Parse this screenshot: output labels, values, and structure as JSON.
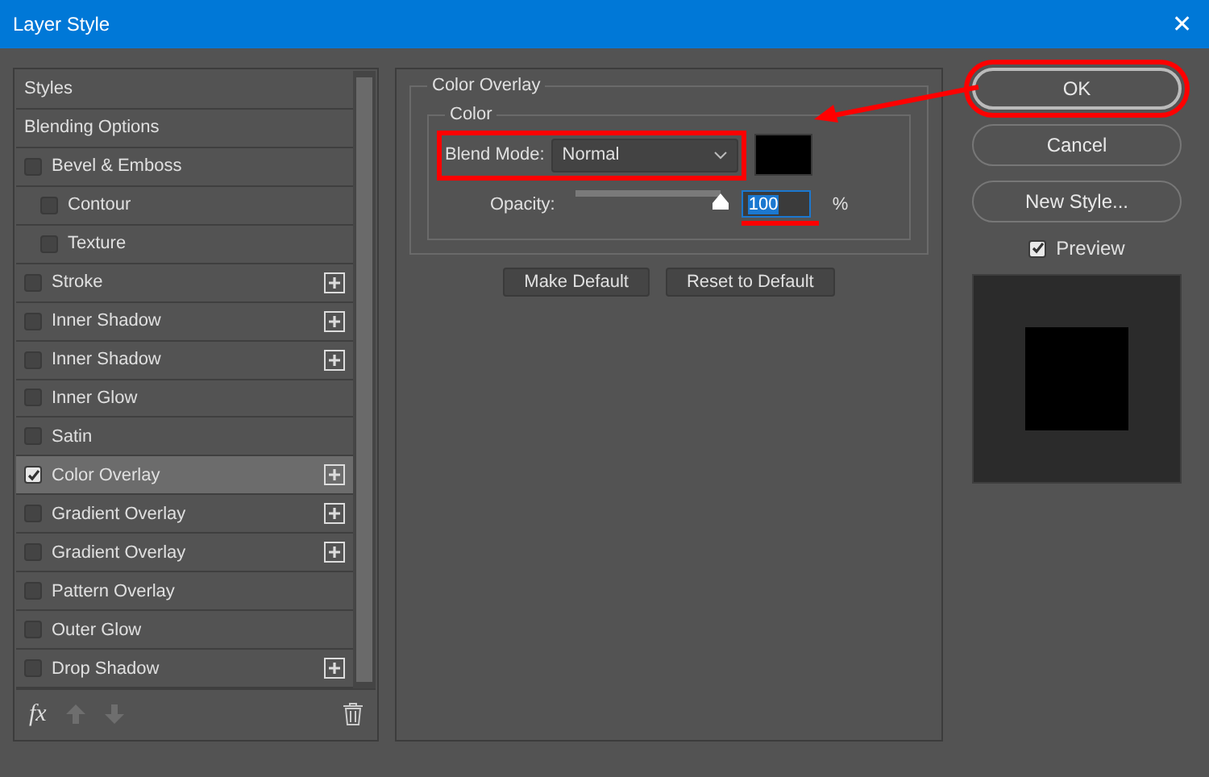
{
  "window": {
    "title": "Layer Style",
    "close": "✕"
  },
  "styles_list": {
    "items": [
      {
        "kind": "header",
        "label": "Styles",
        "selected": false
      },
      {
        "kind": "header",
        "label": "Blending Options",
        "selected": false
      },
      {
        "kind": "effect",
        "label": "Bevel & Emboss",
        "checked": false,
        "selected": false,
        "addable": false,
        "children": [
          {
            "kind": "effect",
            "label": "Contour",
            "checked": false,
            "selected": false,
            "addable": false
          },
          {
            "kind": "effect",
            "label": "Texture",
            "checked": false,
            "selected": false,
            "addable": false
          }
        ]
      },
      {
        "kind": "effect",
        "label": "Stroke",
        "checked": false,
        "selected": false,
        "addable": true
      },
      {
        "kind": "effect",
        "label": "Inner Shadow",
        "checked": false,
        "selected": false,
        "addable": true
      },
      {
        "kind": "effect",
        "label": "Inner Shadow",
        "checked": false,
        "selected": false,
        "addable": true
      },
      {
        "kind": "effect",
        "label": "Inner Glow",
        "checked": false,
        "selected": false,
        "addable": false
      },
      {
        "kind": "effect",
        "label": "Satin",
        "checked": false,
        "selected": false,
        "addable": false
      },
      {
        "kind": "effect",
        "label": "Color Overlay",
        "checked": true,
        "selected": true,
        "addable": true
      },
      {
        "kind": "effect",
        "label": "Gradient Overlay",
        "checked": false,
        "selected": false,
        "addable": true
      },
      {
        "kind": "effect",
        "label": "Gradient Overlay",
        "checked": false,
        "selected": false,
        "addable": true
      },
      {
        "kind": "effect",
        "label": "Pattern Overlay",
        "checked": false,
        "selected": false,
        "addable": false
      },
      {
        "kind": "effect",
        "label": "Outer Glow",
        "checked": false,
        "selected": false,
        "addable": false
      },
      {
        "kind": "effect",
        "label": "Drop Shadow",
        "checked": false,
        "selected": false,
        "addable": true
      }
    ],
    "fx_label": "fx"
  },
  "settings": {
    "group_title": "Color Overlay",
    "subgroup_title": "Color",
    "blend_mode": {
      "label": "Blend Mode:",
      "value": "Normal",
      "highlighted": true
    },
    "opacity": {
      "label": "Opacity:",
      "level": 1.0,
      "value": "100",
      "unit": "%",
      "underlined": true
    },
    "buttons": [
      "Make Default",
      "Reset to Default"
    ]
  },
  "actions": [
    {
      "label": "OK",
      "highlighted": true
    },
    {
      "label": "Cancel",
      "highlighted": false
    },
    {
      "label": "New Style...",
      "highlighted": false
    }
  ],
  "preview": {
    "label": "Preview",
    "checked": true
  }
}
